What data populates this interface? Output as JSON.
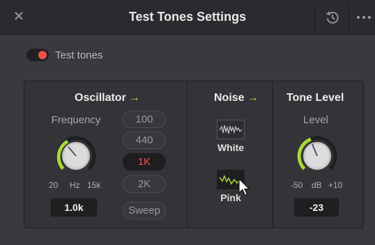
{
  "window": {
    "title": "Test Tones Settings"
  },
  "icons": {
    "close": "close-icon",
    "reset": "reset-icon",
    "more": "more-icon"
  },
  "toggle": {
    "label": "Test tones",
    "on": true,
    "accent": "#f0504a"
  },
  "oscillator": {
    "title": "Oscillator",
    "arrow": "→",
    "frequency_label": "Frequency",
    "scale": {
      "min": "20",
      "unit": "Hz",
      "max": "15k"
    },
    "value": "1.0k",
    "presets": [
      {
        "label": "100",
        "active": false
      },
      {
        "label": "440",
        "active": false
      },
      {
        "label": "1K",
        "active": true
      },
      {
        "label": "2K",
        "active": false
      },
      {
        "label": "Sweep",
        "active": false
      }
    ]
  },
  "noise": {
    "title": "Noise",
    "arrow": "→",
    "options": [
      {
        "label": "White",
        "selected": false
      },
      {
        "label": "Pink",
        "selected": true
      }
    ]
  },
  "tone_level": {
    "title": "Tone Level",
    "level_label": "Level",
    "scale": {
      "min": "-50",
      "unit": "dB",
      "max": "+10"
    },
    "value": "-23"
  },
  "colors": {
    "accent_green": "#a6d83a",
    "arrow_yellow": "#d8d83a",
    "active_red": "#ff4a44"
  }
}
